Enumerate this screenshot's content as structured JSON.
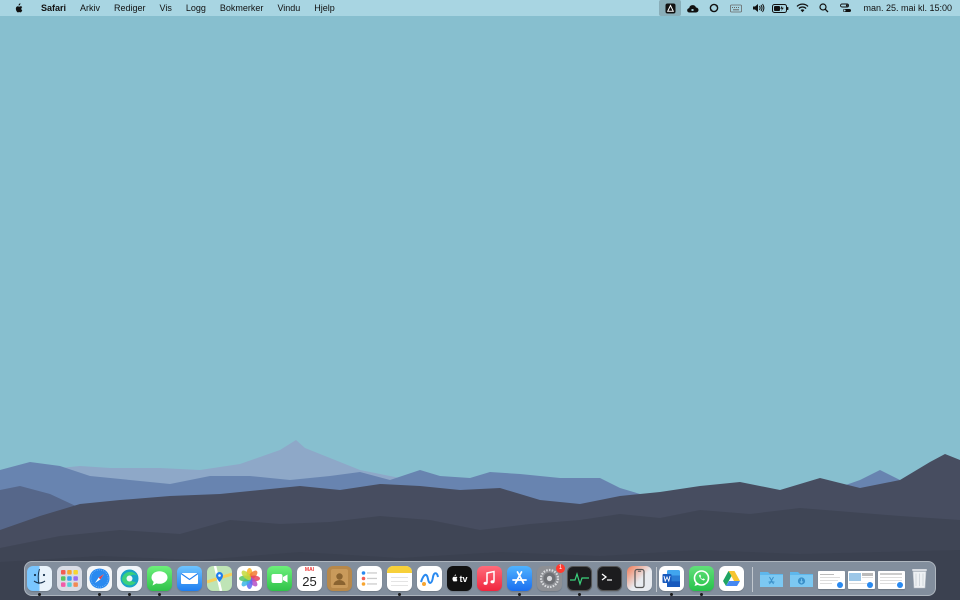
{
  "menubar": {
    "app_name": "Safari",
    "menus": [
      "Arkiv",
      "Rediger",
      "Vis",
      "Logg",
      "Bokmerker",
      "Vindu",
      "Hjelp"
    ],
    "status_icons": [
      "a-app-icon",
      "creative-cloud-icon",
      "sync-icon",
      "keyboard-input-icon",
      "volume-icon",
      "battery-icon",
      "wifi-icon",
      "spotlight-search-icon",
      "control-center-icon"
    ],
    "clock": "man. 25. mai kl. 15:00"
  },
  "dock": {
    "apps": [
      {
        "name": "Finder",
        "icon": "finder-icon",
        "running": true
      },
      {
        "name": "Launchpad",
        "icon": "launchpad-icon",
        "running": false
      },
      {
        "name": "Safari",
        "icon": "safari-icon",
        "running": true
      },
      {
        "name": "Microsoft Edge",
        "icon": "edge-icon",
        "running": true
      },
      {
        "name": "Messages",
        "icon": "messages-icon",
        "running": true
      },
      {
        "name": "Mail",
        "icon": "mail-icon",
        "running": false
      },
      {
        "name": "Maps",
        "icon": "maps-icon",
        "running": false
      },
      {
        "name": "Photos",
        "icon": "photos-icon",
        "running": false
      },
      {
        "name": "FaceTime",
        "icon": "facetime-icon",
        "running": false
      },
      {
        "name": "Calendar",
        "icon": "calendar-icon",
        "running": false,
        "month": "MAI",
        "day": "25"
      },
      {
        "name": "Contacts",
        "icon": "contacts-icon",
        "running": false
      },
      {
        "name": "Reminders",
        "icon": "reminders-icon",
        "running": false
      },
      {
        "name": "Notes",
        "icon": "notes-icon",
        "running": true
      },
      {
        "name": "Freeform",
        "icon": "freeform-icon",
        "running": false
      },
      {
        "name": "Apple TV",
        "icon": "apple-tv-icon",
        "running": false,
        "label": "tv"
      },
      {
        "name": "Music",
        "icon": "music-icon",
        "running": false
      },
      {
        "name": "App Store",
        "icon": "app-store-icon",
        "running": true
      },
      {
        "name": "System Settings",
        "icon": "system-settings-icon",
        "running": false,
        "badge": "1"
      },
      {
        "name": "Activity Monitor",
        "icon": "activity-monitor-icon",
        "running": true
      },
      {
        "name": "Terminal",
        "icon": "terminal-icon",
        "running": false
      },
      {
        "name": "iPhone Mirroring",
        "icon": "iphone-mirroring-icon",
        "running": false
      },
      {
        "name": "Microsoft Word",
        "icon": "word-icon",
        "running": true
      },
      {
        "name": "WhatsApp",
        "icon": "whatsapp-icon",
        "running": true
      },
      {
        "name": "Google Drive",
        "icon": "google-drive-icon",
        "running": false
      }
    ],
    "stacks": [
      {
        "name": "Applications",
        "icon": "applications-folder-icon"
      },
      {
        "name": "Downloads",
        "icon": "downloads-folder-icon"
      },
      {
        "name": "Document 1",
        "icon": "document-thumbnail-icon"
      },
      {
        "name": "Document 2",
        "icon": "document-thumbnail-icon"
      },
      {
        "name": "Document 3",
        "icon": "document-thumbnail-icon"
      },
      {
        "name": "Trash",
        "icon": "trash-icon"
      }
    ]
  },
  "colors": {
    "sky": "#87bfcf",
    "menubar": "#aad7e4",
    "mountain_far": "#8aa6c6",
    "mountain_mid": "#6682ad",
    "mountain_near": "#464c5e",
    "mountain_front": "#3f4656"
  }
}
